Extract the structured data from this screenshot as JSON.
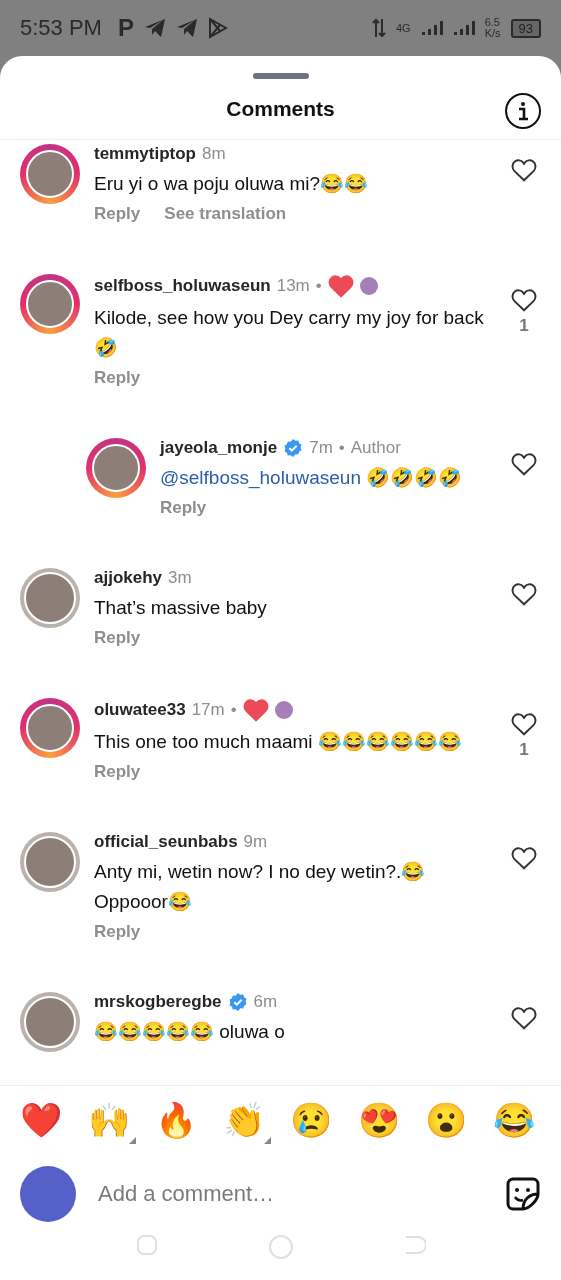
{
  "status_bar": {
    "time": "5:53 PM",
    "notification_icons": [
      {
        "kind": "letter",
        "label": "P"
      },
      {
        "kind": "telegram"
      },
      {
        "kind": "telegram"
      },
      {
        "kind": "play"
      }
    ],
    "network": "4G",
    "speed": "6.5",
    "speed_unit": "K/s",
    "battery": "93"
  },
  "sheet": {
    "title": "Comments"
  },
  "comments": [
    {
      "user": "temmytiptop",
      "time": "8m",
      "verified": false,
      "story_ring": true,
      "liked_by_author": false,
      "text": "Eru yi o wa poju oluwa mi?😂😂",
      "actions": [
        "Reply",
        "See translation"
      ],
      "liked": false
    },
    {
      "user": "selfboss_holuwaseun",
      "time": "13m",
      "separator": "•",
      "verified": false,
      "story_ring": true,
      "liked_by_author": true,
      "text": "Kilode, see how you Dey carry my joy for back 🤣",
      "actions": [
        "Reply"
      ],
      "liked": false,
      "like_count": "1",
      "children": [
        {
          "user": "jayeola_monje",
          "time": "7m",
          "verified": true,
          "separator": "•",
          "tag": "Author",
          "story_ring": true,
          "liked_by_author": false,
          "mention": "@selfboss_holuwaseun",
          "text": "🤣🤣🤣🤣",
          "actions": [
            "Reply"
          ],
          "liked": false
        }
      ]
    },
    {
      "user": "ajjokehy",
      "time": "3m",
      "verified": false,
      "story_ring": false,
      "liked_by_author": false,
      "text": "That’s massive baby",
      "actions": [
        "Reply"
      ],
      "liked": false
    },
    {
      "user": "oluwatee33",
      "time": "17m",
      "separator": "•",
      "verified": false,
      "story_ring": true,
      "liked_by_author": true,
      "text": "This one too much maami 😂😂😂😂😂😂",
      "actions": [
        "Reply"
      ],
      "liked": false,
      "like_count": "1"
    },
    {
      "user": "official_seunbabs",
      "time": "9m",
      "verified": false,
      "story_ring": false,
      "liked_by_author": false,
      "text": "Anty mi, wetin now? I no dey wetin?.😂 Oppooor😂",
      "actions": [
        "Reply"
      ],
      "liked": false
    },
    {
      "user": "mrskogberegbe",
      "time": "6m",
      "verified": true,
      "story_ring": false,
      "liked_by_author": false,
      "text": "😂😂😂😂😂 oluwa o",
      "liked": false
    }
  ],
  "quick_reactions": [
    {
      "emoji": "❤️",
      "has_variants": false
    },
    {
      "emoji": "🙌",
      "has_variants": true
    },
    {
      "emoji": "🔥",
      "has_variants": false
    },
    {
      "emoji": "👏",
      "has_variants": true
    },
    {
      "emoji": "😢",
      "has_variants": false
    },
    {
      "emoji": "😍",
      "has_variants": false
    },
    {
      "emoji": "😮",
      "has_variants": false
    },
    {
      "emoji": "😂",
      "has_variants": false
    }
  ],
  "composer": {
    "placeholder": "Add a comment…"
  }
}
